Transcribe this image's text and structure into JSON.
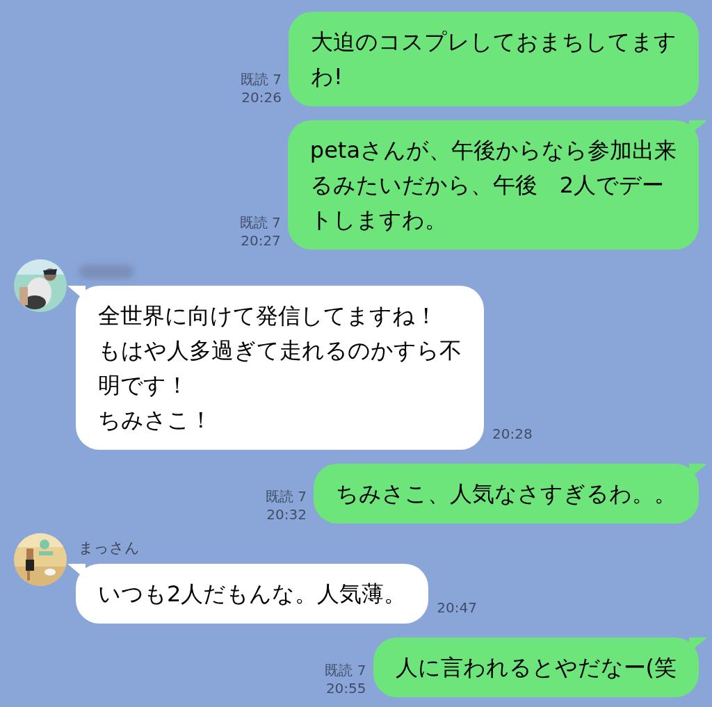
{
  "messages": [
    {
      "kind": "sent",
      "lines": [
        "大迫のコスプレしておまちしてます",
        "わ!"
      ],
      "read": "既読 7",
      "time": "20:26",
      "tail": false
    },
    {
      "kind": "sent",
      "lines": [
        "petaさんが、午後からなら参加出来",
        "るみたいだから、午後　2人でデー",
        "トしますわ。"
      ],
      "read": "既読 7",
      "time": "20:27",
      "tail": true
    },
    {
      "kind": "received",
      "name_hidden": true,
      "lines": [
        "全世界に向けて発信してますね！",
        "もはや人多過ぎて走れるのかすら不",
        "明です！",
        "ちみさこ！"
      ],
      "time": "20:28",
      "tail": true
    },
    {
      "kind": "sent",
      "lines": [
        "ちみさこ、人気なさすぎるわ。。"
      ],
      "read": "既読 7",
      "time": "20:32",
      "tail": true
    },
    {
      "kind": "received",
      "name": "まっさん",
      "lines": [
        "いつも2人だもんな。人気薄。"
      ],
      "time": "20:47",
      "tail": true
    },
    {
      "kind": "sent",
      "lines": [
        "人に言われるとやだなー(笑"
      ],
      "read": "既読 7",
      "time": "20:55",
      "tail": true
    }
  ]
}
